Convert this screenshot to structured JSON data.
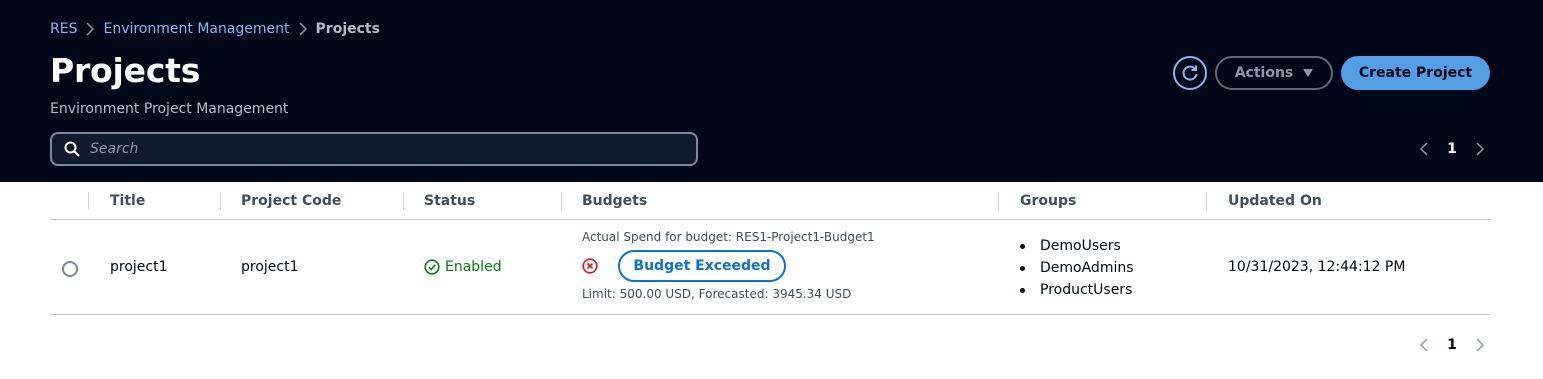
{
  "breadcrumb": {
    "items": [
      "RES",
      "Environment Management"
    ],
    "current": "Projects"
  },
  "header": {
    "title": "Projects",
    "subtitle": "Environment Project Management",
    "actions_label": "Actions",
    "create_label": "Create Project"
  },
  "search": {
    "placeholder": "Search",
    "value": ""
  },
  "pagination": {
    "page": "1"
  },
  "table": {
    "columns": [
      "Title",
      "Project Code",
      "Status",
      "Budgets",
      "Groups",
      "Updated On"
    ],
    "rows": [
      {
        "title": "project1",
        "project_code": "project1",
        "status": "Enabled",
        "budget_label": "Actual Spend for budget: RES1-Project1-Budget1",
        "budget_badge": "Budget Exceeded",
        "budget_limit": "Limit: 500.00 USD, Forecasted: 3945.34 USD",
        "groups": [
          "DemoUsers",
          "DemoAdmins",
          "ProductUsers"
        ],
        "updated_on": "10/31/2023, 12:44:12 PM"
      }
    ]
  },
  "icons": {
    "refresh": "refresh-icon",
    "search": "search-icon",
    "status_ok": "check-circle-icon",
    "budget_error": "error-circle-icon",
    "prev": "chevron-left-icon",
    "next": "chevron-right-icon"
  },
  "colors": {
    "header_bg": "#000716",
    "link": "#7fbbf2",
    "primary_button": "#539fe5",
    "success": "#037f0c",
    "error": "#d91515",
    "badge": "#0972d3"
  }
}
